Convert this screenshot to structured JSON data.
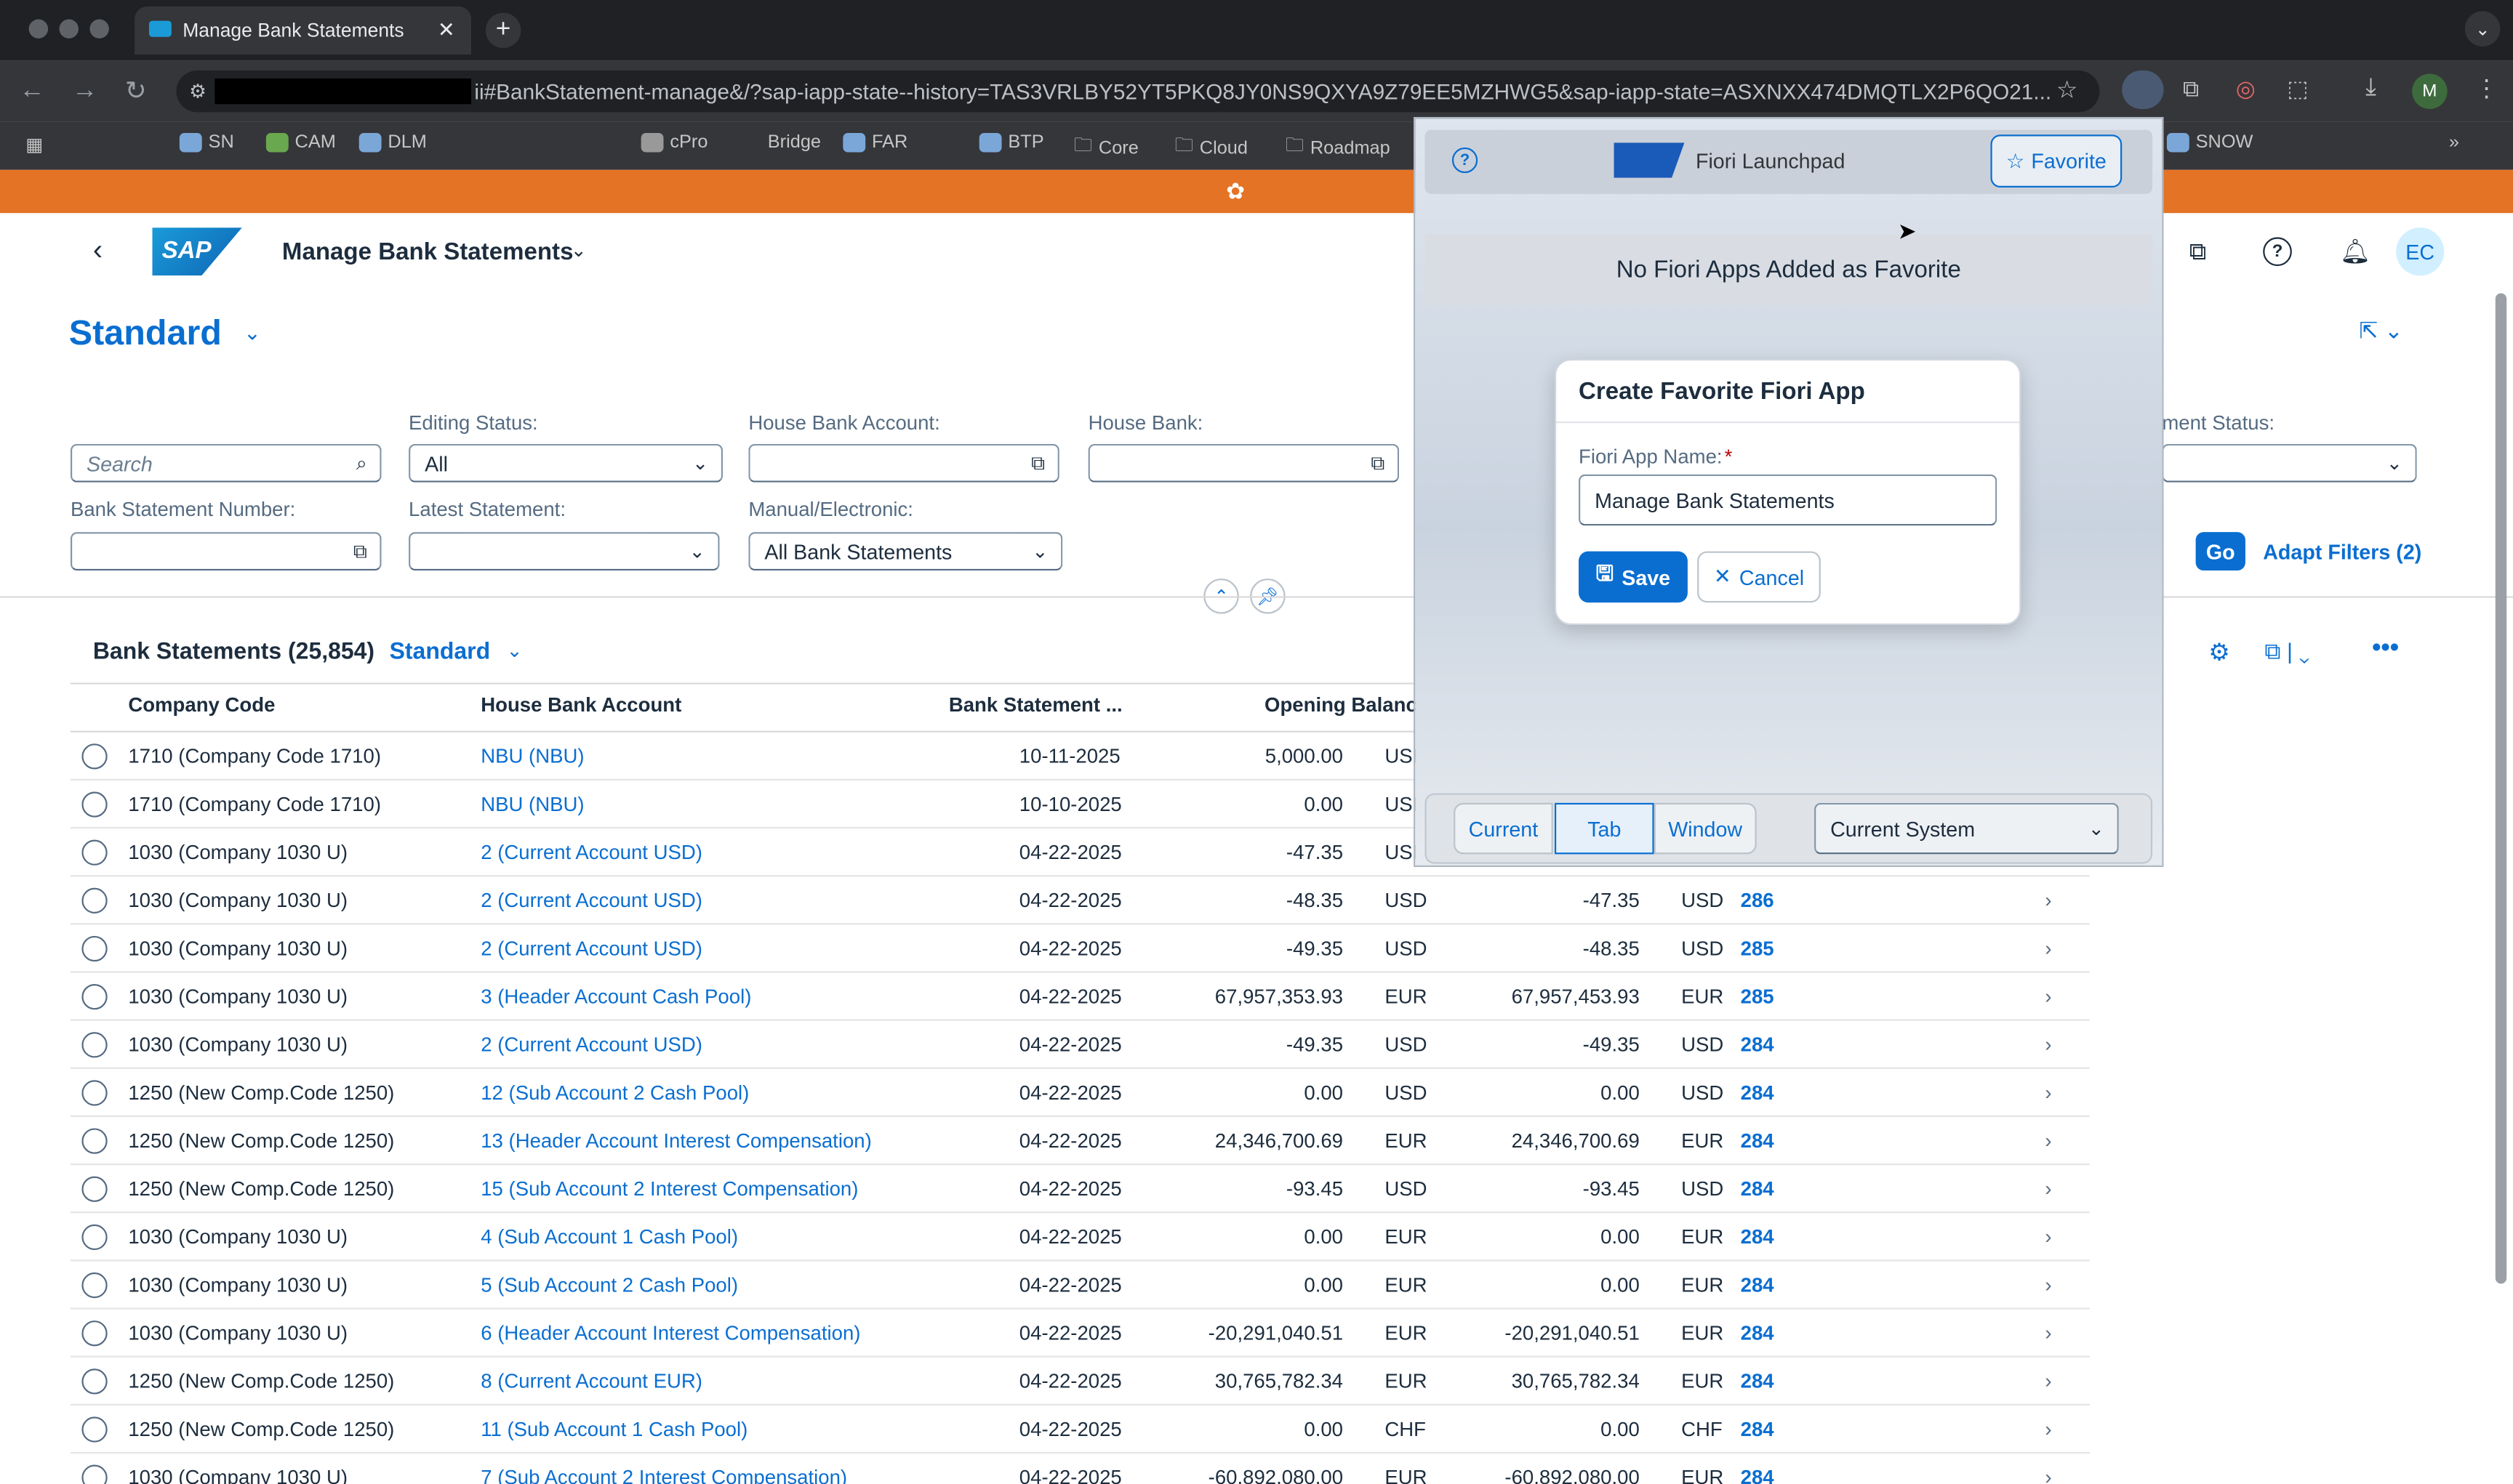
{
  "browser": {
    "tab_title": "Manage Bank Statements",
    "url": "ii#BankStatement-manage&/?sap-iapp-state--history=TAS3VRLBY52YT5PKQ8JY0NS9QXYA9Z79EE5MZHWG5&sap-iapp-state=ASXNXX474DMQTLX2P6QO21...",
    "profile_initial": "M",
    "bookmarks": [
      "SN",
      "CAM",
      "DLM",
      "cPro",
      "Bridge",
      "FAR",
      "BTP",
      "Core",
      "Cloud",
      "Roadmap",
      "SNOW"
    ]
  },
  "app": {
    "title": "Manage Bank Statements",
    "variant": "Standard",
    "user_initials": "EC"
  },
  "filters": {
    "search_placeholder": "Search",
    "editing_status_label": "Editing Status:",
    "editing_status_value": "All",
    "house_bank_account_label": "House Bank Account:",
    "house_bank_label": "House Bank:",
    "statement_status_label": "ment Status:",
    "bank_statement_number_label": "Bank Statement Number:",
    "latest_statement_label": "Latest Statement:",
    "manual_electronic_label": "Manual/Electronic:",
    "manual_electronic_value": "All Bank Statements",
    "go_label": "Go",
    "adapt_label": "Adapt Filters (2)"
  },
  "table": {
    "title": "Bank Statements (25,854)",
    "variant": "Standard",
    "headers": [
      "Company Code",
      "House Bank Account",
      "Bank Statement ...",
      "Opening Balance"
    ],
    "rows": [
      [
        "1710 (Company Code 1710)",
        "NBU (NBU)",
        "10-11-2025",
        "5,000.00",
        "USD",
        "",
        "",
        "",
        ""
      ],
      [
        "1710 (Company Code 1710)",
        "NBU (NBU)",
        "10-10-2025",
        "0.00",
        "USD",
        "",
        "",
        "",
        ""
      ],
      [
        "1030 (Company 1030 U)",
        "2 (Current Account USD)",
        "04-22-2025",
        "-47.35",
        "USD",
        "",
        "",
        "",
        ""
      ],
      [
        "1030 (Company 1030 U)",
        "2 (Current Account USD)",
        "04-22-2025",
        "-48.35",
        "USD",
        "-47.35",
        "USD",
        "286",
        ""
      ],
      [
        "1030 (Company 1030 U)",
        "2 (Current Account USD)",
        "04-22-2025",
        "-49.35",
        "USD",
        "-48.35",
        "USD",
        "285",
        ""
      ],
      [
        "1030 (Company 1030 U)",
        "3 (Header Account Cash Pool)",
        "04-22-2025",
        "67,957,353.93",
        "EUR",
        "67,957,453.93",
        "EUR",
        "285",
        ""
      ],
      [
        "1030 (Company 1030 U)",
        "2 (Current Account USD)",
        "04-22-2025",
        "-49.35",
        "USD",
        "-49.35",
        "USD",
        "284",
        ""
      ],
      [
        "1250 (New Comp.Code 1250)",
        "12 (Sub Account 2 Cash Pool)",
        "04-22-2025",
        "0.00",
        "USD",
        "0.00",
        "USD",
        "284",
        ""
      ],
      [
        "1250 (New Comp.Code 1250)",
        "13 (Header Account Interest Compensation)",
        "04-22-2025",
        "24,346,700.69",
        "EUR",
        "24,346,700.69",
        "EUR",
        "284",
        ""
      ],
      [
        "1250 (New Comp.Code 1250)",
        "15 (Sub Account 2 Interest Compensation)",
        "04-22-2025",
        "-93.45",
        "USD",
        "-93.45",
        "USD",
        "284",
        ""
      ],
      [
        "1030 (Company 1030 U)",
        "4 (Sub Account 1 Cash Pool)",
        "04-22-2025",
        "0.00",
        "EUR",
        "0.00",
        "EUR",
        "284",
        ""
      ],
      [
        "1030 (Company 1030 U)",
        "5 (Sub Account 2 Cash Pool)",
        "04-22-2025",
        "0.00",
        "EUR",
        "0.00",
        "EUR",
        "284",
        ""
      ],
      [
        "1030 (Company 1030 U)",
        "6 (Header Account Interest Compensation)",
        "04-22-2025",
        "-20,291,040.51",
        "EUR",
        "-20,291,040.51",
        "EUR",
        "284",
        ""
      ],
      [
        "1250 (New Comp.Code 1250)",
        "8 (Current Account EUR)",
        "04-22-2025",
        "30,765,782.34",
        "EUR",
        "30,765,782.34",
        "EUR",
        "284",
        ""
      ],
      [
        "1250 (New Comp.Code 1250)",
        "11 (Sub Account 1 Cash Pool)",
        "04-22-2025",
        "0.00",
        "CHF",
        "0.00",
        "CHF",
        "284",
        ""
      ],
      [
        "1030 (Company 1030 U)",
        "7 (Sub Account 2 Interest Compensation)",
        "04-22-2025",
        "-60,892,080.00",
        "EUR",
        "-60,892,080.00",
        "EUR",
        "284",
        ""
      ]
    ]
  },
  "popup": {
    "title": "Fiori Launchpad",
    "favorite_label": "Favorite",
    "empty_text": "No Fiori Apps Added as Favorite",
    "dialog_title": "Create Favorite Fiori App",
    "name_label": "Fiori App Name:",
    "required_mark": "*",
    "name_value": "Manage Bank Statements",
    "save_label": "Save",
    "cancel_label": "Cancel",
    "open_modes": [
      "Current",
      "Tab",
      "Window"
    ],
    "selected_mode": "Tab",
    "system_value": "Current System"
  },
  "colors": {
    "accent": "#0a6ed1",
    "shell": "#e57325"
  }
}
